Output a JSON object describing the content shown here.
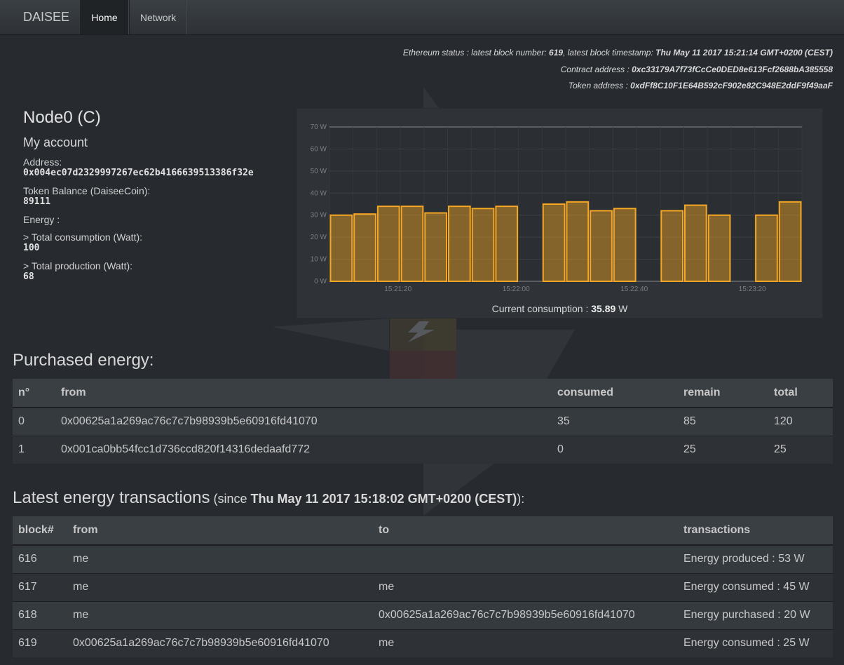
{
  "navbar": {
    "brand": "DAISEE",
    "tabs": [
      {
        "label": "Home",
        "active": true
      },
      {
        "label": "Network",
        "active": false
      }
    ]
  },
  "ethereum": {
    "status_prefix": "Ethereum status : latest block number: ",
    "block_number": "619",
    "timestamp_prefix": ", latest block timestamp: ",
    "timestamp": "Thu May 11 2017 15:21:14 GMT+0200 (CEST)",
    "contract_label": "Contract address : ",
    "contract_address": "0xc33179A7f73fCcCe0DED8e613Fcf2688bA385558",
    "token_label": "Token address : ",
    "token_address": "0xdFf8C10F1E64B592cF902e82C948E2ddF9f49aaF"
  },
  "account": {
    "node_name": "Node0 (C)",
    "title": "My account",
    "address_label": "Address:",
    "address": "0x004ec07d2329997267ec62b4166639513386f32e",
    "balance_label": "Token Balance (DaiseeCoin):",
    "balance": "89111",
    "energy_label": "Energy :",
    "consumption_label": "> Total consumption (Watt):",
    "consumption": "100",
    "production_label": "> Total production (Watt):",
    "production": "68"
  },
  "chart_data": {
    "type": "bar",
    "ylim": [
      0,
      70
    ],
    "y_ticks": [
      "0 W",
      "10 W",
      "20 W",
      "30 W",
      "40 W",
      "50 W",
      "60 W",
      "70 W"
    ],
    "x_ticks": [
      "15:21:20",
      "15:22:00",
      "15:22:40",
      "15:23:20"
    ],
    "values": [
      30,
      30.5,
      34,
      34,
      31,
      34,
      33,
      34,
      null,
      35,
      36,
      32,
      33,
      null,
      32,
      34.5,
      30,
      null,
      30,
      36
    ],
    "bar_color": "#f5a623",
    "current_label": "Current consumption : ",
    "current_value": "35.89",
    "current_unit": " W"
  },
  "purchased": {
    "heading": "Purchased energy:",
    "columns": [
      "n°",
      "from",
      "consumed",
      "remain",
      "total"
    ],
    "rows": [
      [
        "0",
        "0x00625a1a269ac76c7c7b98939b5e60916fd41070",
        "35",
        "85",
        "120"
      ],
      [
        "1",
        "0x001ca0bb54fcc1d736ccd820f14316dedaafd772",
        "0",
        "25",
        "25"
      ]
    ]
  },
  "transactions": {
    "heading": "Latest energy transactions",
    "since_open": " (since ",
    "since_date": "Thu May 11 2017 15:18:02 GMT+0200 (CEST)",
    "since_close": "):",
    "columns": [
      "block#",
      "from",
      "to",
      "transactions"
    ],
    "rows": [
      [
        "616",
        "me",
        "",
        "Energy produced : 53 W"
      ],
      [
        "617",
        "me",
        "me",
        "Energy consumed : 45 W"
      ],
      [
        "618",
        "me",
        "0x00625a1a269ac76c7c7b98939b5e60916fd41070",
        "Energy purchased : 20 W"
      ],
      [
        "619",
        "0x00625a1a269ac76c7c7b98939b5e60916fd41070",
        "me",
        "Energy consumed : 25 W"
      ]
    ]
  }
}
